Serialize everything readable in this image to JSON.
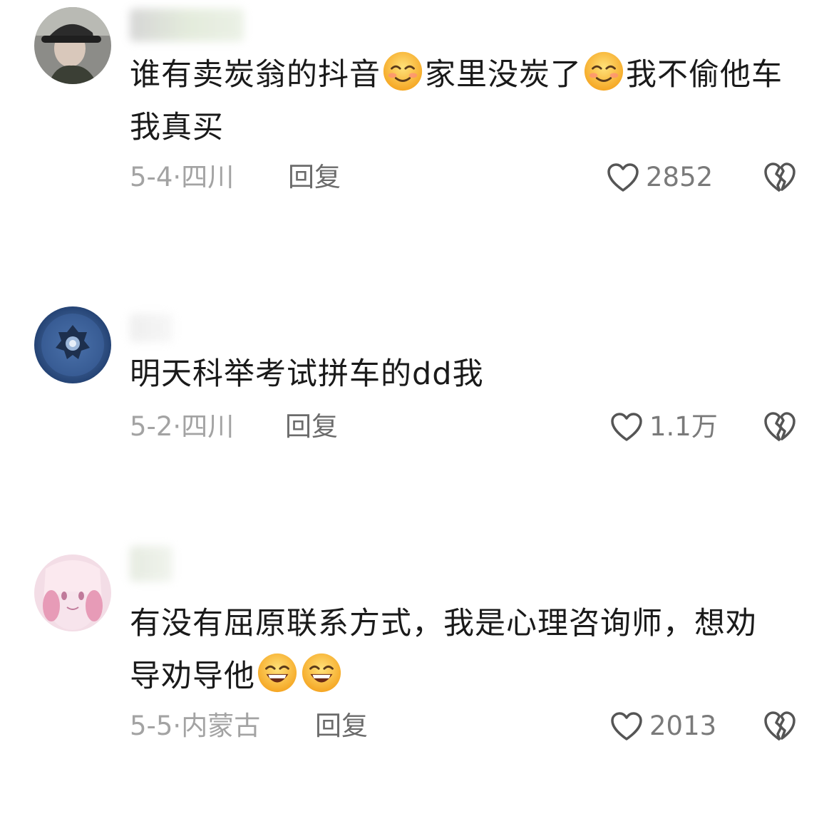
{
  "comments": [
    {
      "text_parts": [
        "谁有卖炭翁的抖音",
        "家里没炭了",
        "我不偷他车 我真买"
      ],
      "emoji": "smiling-face-emoji",
      "date": "5-4·",
      "location": "四川",
      "reply_label": "回复",
      "likes": "2852"
    },
    {
      "text": "明天科举考试拼车的dd我",
      "date": "5-2·",
      "location": "四川",
      "reply_label": "回复",
      "likes": "1.1万"
    },
    {
      "text": "有没有屈原联系方式，我是心理咨询师，想劝导劝导他",
      "emoji": "grinning-squinting-face-emoji",
      "date": "5-5·",
      "location": "内蒙古",
      "reply_label": "回复",
      "likes": "2013"
    }
  ],
  "icons": {
    "like": "heart-outline-icon",
    "dislike": "broken-heart-icon"
  },
  "colors": {
    "text": "#1a1a1a",
    "meta": "#a3a3a3",
    "reply": "#6b6b6b",
    "icon": "#555555"
  }
}
